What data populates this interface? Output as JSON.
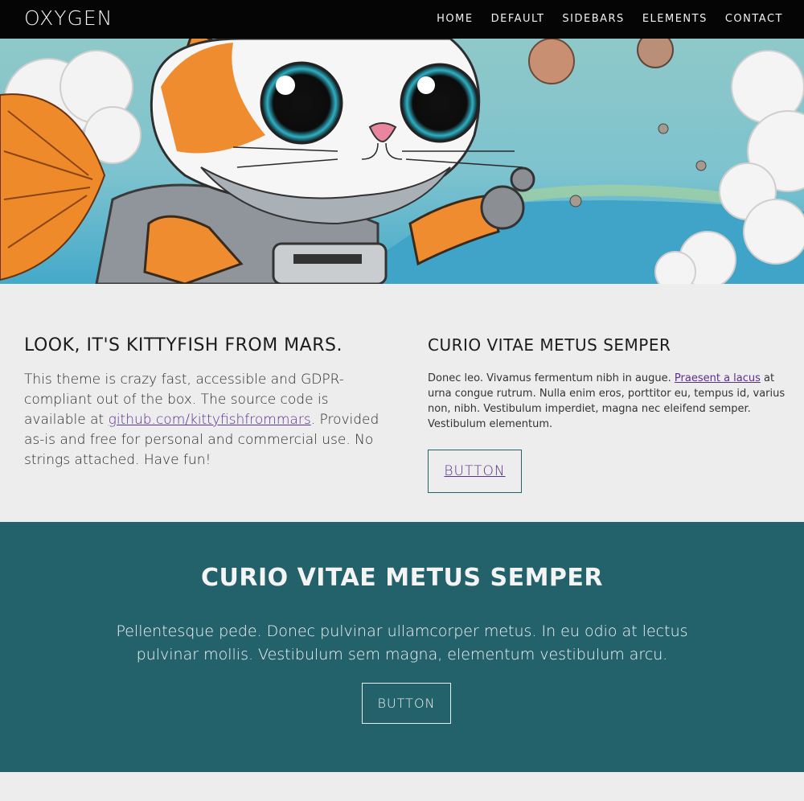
{
  "header": {
    "brand": "OXYGEN",
    "nav": [
      "HOME",
      "DEFAULT",
      "SIDEBARS",
      "ELEMENTS",
      "CONTACT"
    ]
  },
  "hero": {
    "image_icon": "astronaut-cat-illustration"
  },
  "intro": {
    "title": "LOOK, IT'S KITTYFISH FROM MARS.",
    "text_before": "This theme is crazy fast, accessible and GDPR-compliant out of the box. The source code is available at ",
    "link": "github.com/kittyfishfrommars",
    "text_after": ". Provided as-is and free for personal and commercial use. No strings attached. Have fun!"
  },
  "side": {
    "title": "CURIO VITAE METUS SEMPER",
    "text_before": "Donec leo. Vivamus fermentum nibh in augue. ",
    "link": "Praesent a lacus",
    "text_after": " at urna congue rutrum. Nulla enim eros, porttitor eu, tempus id, varius non, nibh. Vestibulum imperdiet, magna nec eleifend semper. Vestibulum elementum.",
    "button": "BUTTON"
  },
  "cta": {
    "title": "CURIO VITAE METUS SEMPER",
    "text": "Pellentesque pede. Donec pulvinar ullamcorper metus. In eu odio at lectus pulvinar mollis. Vestibulum sem magna, elementum vestibulum arcu.",
    "button": "BUTTON"
  },
  "colors": {
    "header_bg": "#050505",
    "teal": "#24626b",
    "light_bg": "#ededed",
    "link": "#5b2e8e"
  }
}
